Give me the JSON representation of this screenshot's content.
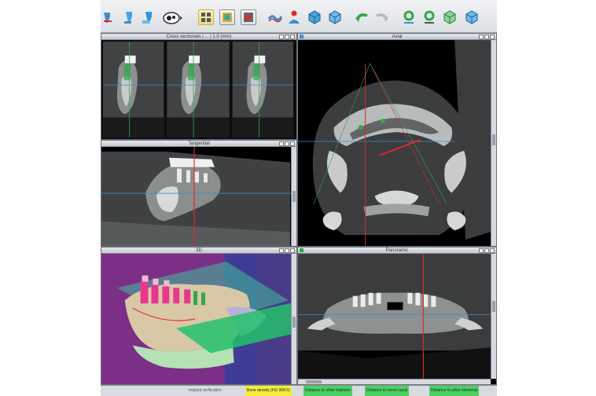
{
  "toolbar": {
    "tools": [
      {
        "icon": "tooth-implant-icon"
      },
      {
        "icon": "tooth-implant-icon"
      },
      {
        "icon": "tooth-implant-icon"
      },
      {
        "icon": "camera-icon"
      },
      {
        "icon": "grid-layout-icon"
      },
      {
        "icon": "grid-layout-icon"
      },
      {
        "icon": "record-icon"
      },
      {
        "icon": "wave-icon"
      },
      {
        "icon": "person-icon"
      },
      {
        "icon": "cube-icon"
      },
      {
        "icon": "cube-icon"
      },
      {
        "icon": "undo-icon"
      },
      {
        "icon": "redo-icon"
      },
      {
        "icon": "gear-icon"
      },
      {
        "icon": "gear-icon"
      },
      {
        "icon": "cube-icon"
      },
      {
        "icon": "cube-icon"
      }
    ]
  },
  "panels": {
    "cross_sections": {
      "title": "Cross sectionals | ... | 1.0 (mm)"
    },
    "axial": {
      "title": "Axial"
    },
    "tangential": {
      "title": "Tangential"
    },
    "three_d": {
      "title": "3D"
    },
    "panoramic": {
      "title": "Panoramic"
    }
  },
  "status": {
    "items": [
      {
        "text": "Implant verification",
        "style": "plain"
      },
      {
        "text": "Bone density (HU 908.5)",
        "style": "yellow"
      },
      {
        "text": "Distance to other implants",
        "style": "green"
      },
      {
        "text": "Distance to nerve canal",
        "style": "green"
      },
      {
        "text": "Distance to other elements",
        "style": "green"
      }
    ]
  },
  "colors": {
    "accent_red": "#e0282a",
    "accent_green": "#2fa84a",
    "accent_blue": "#3a8fd0",
    "implant_pink": "#e8378e",
    "plane_green": "#22c26a",
    "plane_purple": "#7b2f86"
  }
}
